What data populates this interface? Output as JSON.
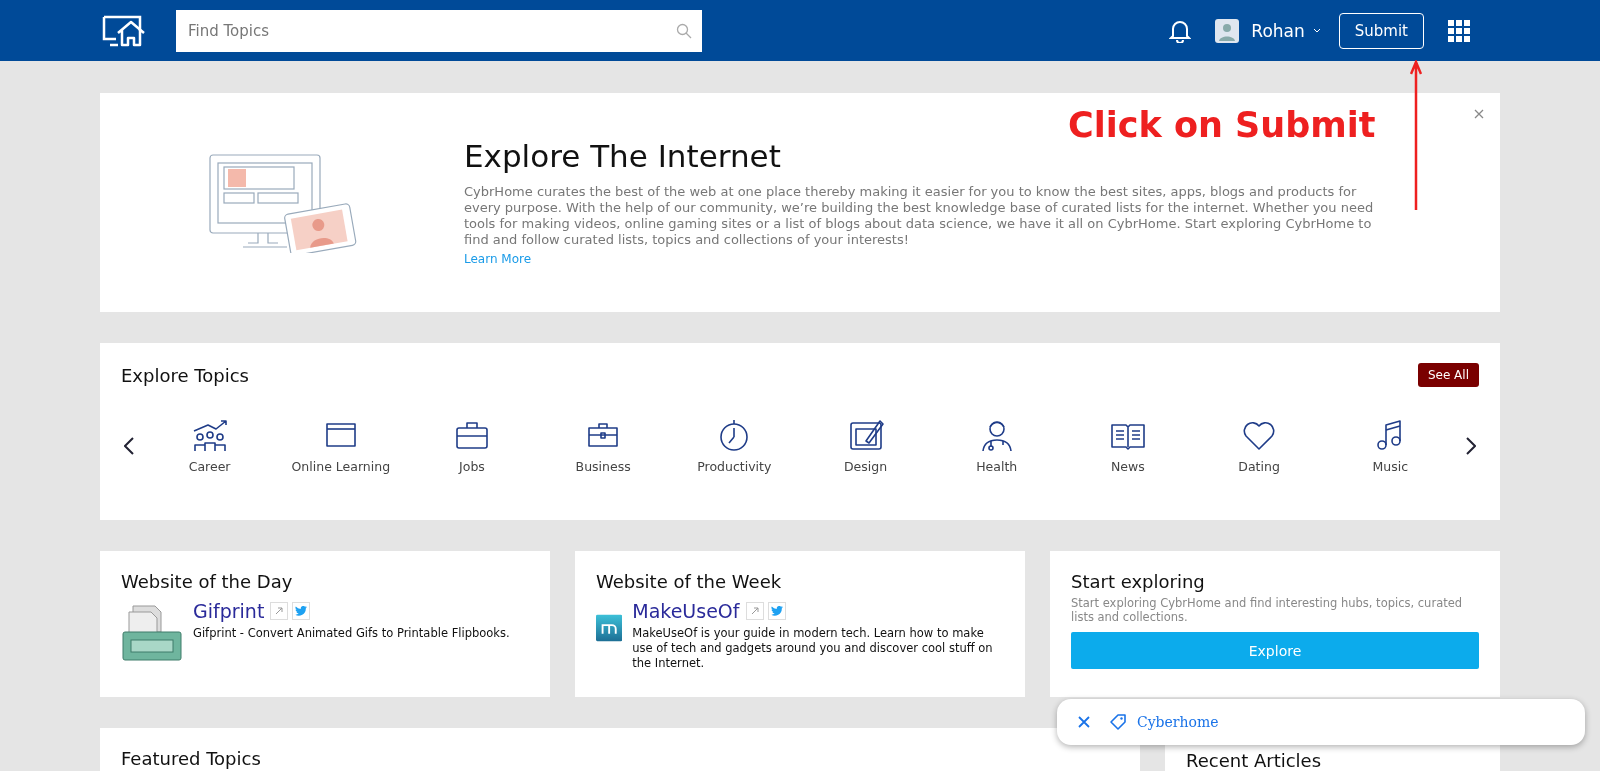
{
  "header": {
    "search": {
      "placeholder": "Find Topics"
    },
    "user": {
      "name": "Rohan"
    },
    "submit": "Submit"
  },
  "annotation": {
    "text": "Click on Submit"
  },
  "banner": {
    "title": "Explore The Internet",
    "text": "CybrHome curates the best of the web at one place thereby making it easier for you to know the best sites, apps, blogs and products for every purpose. With the help of our community, we’re building the best knowledge base of curated lists for the internet. Whether you need tools for making videos, online gaming sites or a list of blogs about data science, we have it all on CybrHome. Start exploring CybrHome to find and follow curated lists, topics and collections of your interests!",
    "link": "Learn More"
  },
  "topics": {
    "title": "Explore Topics",
    "see_all": "See All",
    "items": [
      {
        "label": "Career"
      },
      {
        "label": "Online Learning"
      },
      {
        "label": "Jobs"
      },
      {
        "label": "Business"
      },
      {
        "label": "Productivity"
      },
      {
        "label": "Design"
      },
      {
        "label": "Health"
      },
      {
        "label": "News"
      },
      {
        "label": "Dating"
      },
      {
        "label": "Music"
      }
    ]
  },
  "cards": [
    {
      "kind": "site",
      "title": "Website of the Day",
      "name": "Gifprint",
      "description": "Gifprint - Convert Animated Gifs to Printable Flipbooks."
    },
    {
      "kind": "site",
      "title": "Website of the Week",
      "name": "MakeUseOf",
      "description": "MakeUseOf is your guide in modern tech. Learn how to make use of tech and gadgets around you and discover cool stuff on the Internet."
    },
    {
      "kind": "explore",
      "title": "Start exploring",
      "description": "Start exploring CybrHome and find interesting hubs, topics, curated lists and collections.",
      "button": "Explore"
    }
  ],
  "featured": {
    "title": "Featured Topics"
  },
  "recent": {
    "title": "Recent Articles"
  },
  "popup": {
    "label": "Cyberhome"
  }
}
